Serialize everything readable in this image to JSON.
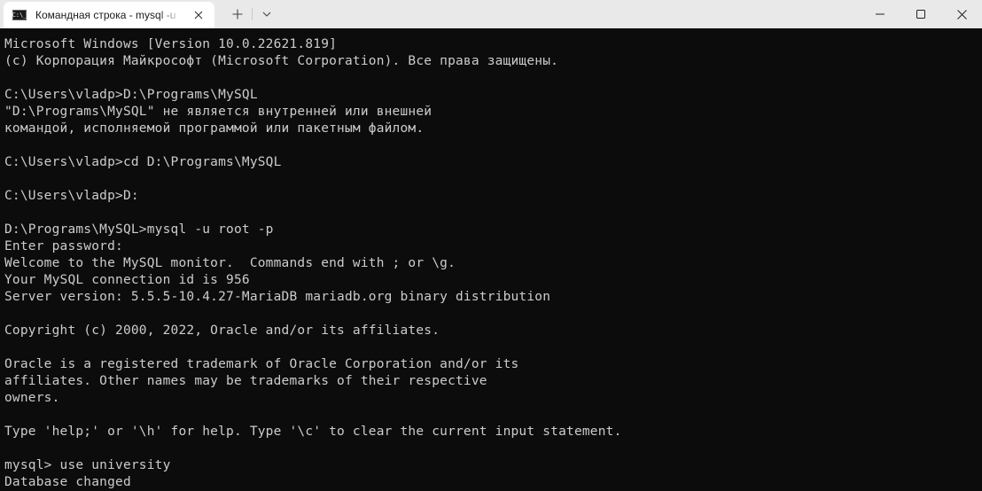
{
  "titlebar": {
    "tab_icon_text": "C:\\_",
    "tab_title": "Командная строка - mysql  -u",
    "tab_close_icon": "close-icon",
    "new_tab_icon": "plus-icon",
    "dropdown_icon": "chevron-down-icon",
    "window_controls": {
      "minimize_icon": "minimize-icon",
      "maximize_icon": "maximize-icon",
      "close_icon": "close-icon"
    }
  },
  "colors": {
    "terminal_bg": "#0c0c0c",
    "terminal_fg": "#cccccc",
    "titlebar_bg": "#e9e9e9",
    "tab_bg": "#ffffff"
  },
  "terminal": {
    "lines": [
      "Microsoft Windows [Version 10.0.22621.819]",
      "(c) Корпорация Майкрософт (Microsoft Corporation). Все права защищены.",
      "",
      "C:\\Users\\vladp>D:\\Programs\\MySQL",
      "\"D:\\Programs\\MySQL\" не является внутренней или внешней",
      "командой, исполняемой программой или пакетным файлом.",
      "",
      "C:\\Users\\vladp>cd D:\\Programs\\MySQL",
      "",
      "C:\\Users\\vladp>D:",
      "",
      "D:\\Programs\\MySQL>mysql -u root -p",
      "Enter password:",
      "Welcome to the MySQL monitor.  Commands end with ; or \\g.",
      "Your MySQL connection id is 956",
      "Server version: 5.5.5-10.4.27-MariaDB mariadb.org binary distribution",
      "",
      "Copyright (c) 2000, 2022, Oracle and/or its affiliates.",
      "",
      "Oracle is a registered trademark of Oracle Corporation and/or its",
      "affiliates. Other names may be trademarks of their respective",
      "owners.",
      "",
      "Type 'help;' or '\\h' for help. Type '\\c' to clear the current input statement.",
      "",
      "mysql> use university",
      "Database changed"
    ]
  }
}
